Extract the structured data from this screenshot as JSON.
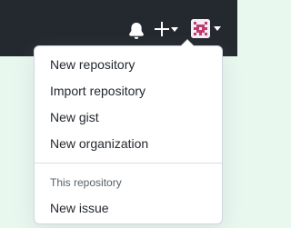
{
  "header": {
    "notifications_icon": "bell-icon",
    "create_icon": "plus-icon",
    "create_caret_icon": "caret-down-icon",
    "avatar_icon": "avatar",
    "avatar_caret_icon": "caret-down-icon"
  },
  "dropdown": {
    "items": [
      {
        "label": "New repository"
      },
      {
        "label": "Import repository"
      },
      {
        "label": "New gist"
      },
      {
        "label": "New organization"
      }
    ],
    "section_header": "This repository",
    "section_items": [
      {
        "label": "New issue"
      }
    ]
  },
  "background": {
    "close_icon": "close-icon"
  },
  "colors": {
    "topbar": "#24292f",
    "page_background": "#e9f8ef",
    "menu_text": "#24292f",
    "section_text": "#57606a",
    "close_icon": "#3a4b43"
  }
}
